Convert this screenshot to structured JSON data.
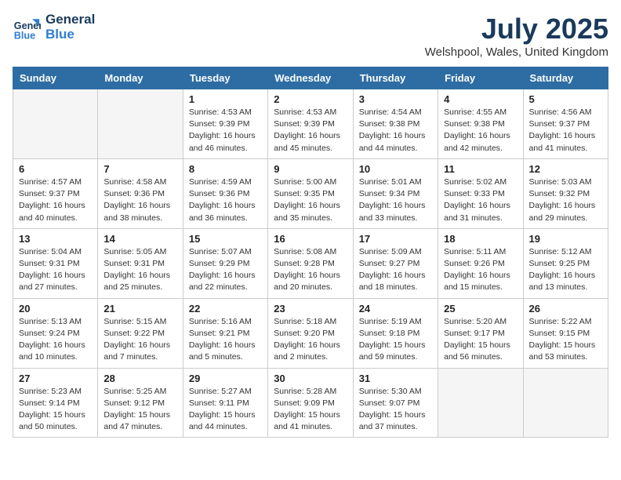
{
  "header": {
    "logo_line1": "General",
    "logo_line2": "Blue",
    "month_year": "July 2025",
    "location": "Welshpool, Wales, United Kingdom"
  },
  "days_of_week": [
    "Sunday",
    "Monday",
    "Tuesday",
    "Wednesday",
    "Thursday",
    "Friday",
    "Saturday"
  ],
  "weeks": [
    [
      {
        "day": "",
        "info": ""
      },
      {
        "day": "",
        "info": ""
      },
      {
        "day": "1",
        "sunrise": "4:53 AM",
        "sunset": "9:39 PM",
        "daylight": "16 hours and 46 minutes."
      },
      {
        "day": "2",
        "sunrise": "4:53 AM",
        "sunset": "9:39 PM",
        "daylight": "16 hours and 45 minutes."
      },
      {
        "day": "3",
        "sunrise": "4:54 AM",
        "sunset": "9:38 PM",
        "daylight": "16 hours and 44 minutes."
      },
      {
        "day": "4",
        "sunrise": "4:55 AM",
        "sunset": "9:38 PM",
        "daylight": "16 hours and 42 minutes."
      },
      {
        "day": "5",
        "sunrise": "4:56 AM",
        "sunset": "9:37 PM",
        "daylight": "16 hours and 41 minutes."
      }
    ],
    [
      {
        "day": "6",
        "sunrise": "4:57 AM",
        "sunset": "9:37 PM",
        "daylight": "16 hours and 40 minutes."
      },
      {
        "day": "7",
        "sunrise": "4:58 AM",
        "sunset": "9:36 PM",
        "daylight": "16 hours and 38 minutes."
      },
      {
        "day": "8",
        "sunrise": "4:59 AM",
        "sunset": "9:36 PM",
        "daylight": "16 hours and 36 minutes."
      },
      {
        "day": "9",
        "sunrise": "5:00 AM",
        "sunset": "9:35 PM",
        "daylight": "16 hours and 35 minutes."
      },
      {
        "day": "10",
        "sunrise": "5:01 AM",
        "sunset": "9:34 PM",
        "daylight": "16 hours and 33 minutes."
      },
      {
        "day": "11",
        "sunrise": "5:02 AM",
        "sunset": "9:33 PM",
        "daylight": "16 hours and 31 minutes."
      },
      {
        "day": "12",
        "sunrise": "5:03 AM",
        "sunset": "9:32 PM",
        "daylight": "16 hours and 29 minutes."
      }
    ],
    [
      {
        "day": "13",
        "sunrise": "5:04 AM",
        "sunset": "9:31 PM",
        "daylight": "16 hours and 27 minutes."
      },
      {
        "day": "14",
        "sunrise": "5:05 AM",
        "sunset": "9:31 PM",
        "daylight": "16 hours and 25 minutes."
      },
      {
        "day": "15",
        "sunrise": "5:07 AM",
        "sunset": "9:29 PM",
        "daylight": "16 hours and 22 minutes."
      },
      {
        "day": "16",
        "sunrise": "5:08 AM",
        "sunset": "9:28 PM",
        "daylight": "16 hours and 20 minutes."
      },
      {
        "day": "17",
        "sunrise": "5:09 AM",
        "sunset": "9:27 PM",
        "daylight": "16 hours and 18 minutes."
      },
      {
        "day": "18",
        "sunrise": "5:11 AM",
        "sunset": "9:26 PM",
        "daylight": "16 hours and 15 minutes."
      },
      {
        "day": "19",
        "sunrise": "5:12 AM",
        "sunset": "9:25 PM",
        "daylight": "16 hours and 13 minutes."
      }
    ],
    [
      {
        "day": "20",
        "sunrise": "5:13 AM",
        "sunset": "9:24 PM",
        "daylight": "16 hours and 10 minutes."
      },
      {
        "day": "21",
        "sunrise": "5:15 AM",
        "sunset": "9:22 PM",
        "daylight": "16 hours and 7 minutes."
      },
      {
        "day": "22",
        "sunrise": "5:16 AM",
        "sunset": "9:21 PM",
        "daylight": "16 hours and 5 minutes."
      },
      {
        "day": "23",
        "sunrise": "5:18 AM",
        "sunset": "9:20 PM",
        "daylight": "16 hours and 2 minutes."
      },
      {
        "day": "24",
        "sunrise": "5:19 AM",
        "sunset": "9:18 PM",
        "daylight": "15 hours and 59 minutes."
      },
      {
        "day": "25",
        "sunrise": "5:20 AM",
        "sunset": "9:17 PM",
        "daylight": "15 hours and 56 minutes."
      },
      {
        "day": "26",
        "sunrise": "5:22 AM",
        "sunset": "9:15 PM",
        "daylight": "15 hours and 53 minutes."
      }
    ],
    [
      {
        "day": "27",
        "sunrise": "5:23 AM",
        "sunset": "9:14 PM",
        "daylight": "15 hours and 50 minutes."
      },
      {
        "day": "28",
        "sunrise": "5:25 AM",
        "sunset": "9:12 PM",
        "daylight": "15 hours and 47 minutes."
      },
      {
        "day": "29",
        "sunrise": "5:27 AM",
        "sunset": "9:11 PM",
        "daylight": "15 hours and 44 minutes."
      },
      {
        "day": "30",
        "sunrise": "5:28 AM",
        "sunset": "9:09 PM",
        "daylight": "15 hours and 41 minutes."
      },
      {
        "day": "31",
        "sunrise": "5:30 AM",
        "sunset": "9:07 PM",
        "daylight": "15 hours and 37 minutes."
      },
      {
        "day": "",
        "info": ""
      },
      {
        "day": "",
        "info": ""
      }
    ]
  ]
}
